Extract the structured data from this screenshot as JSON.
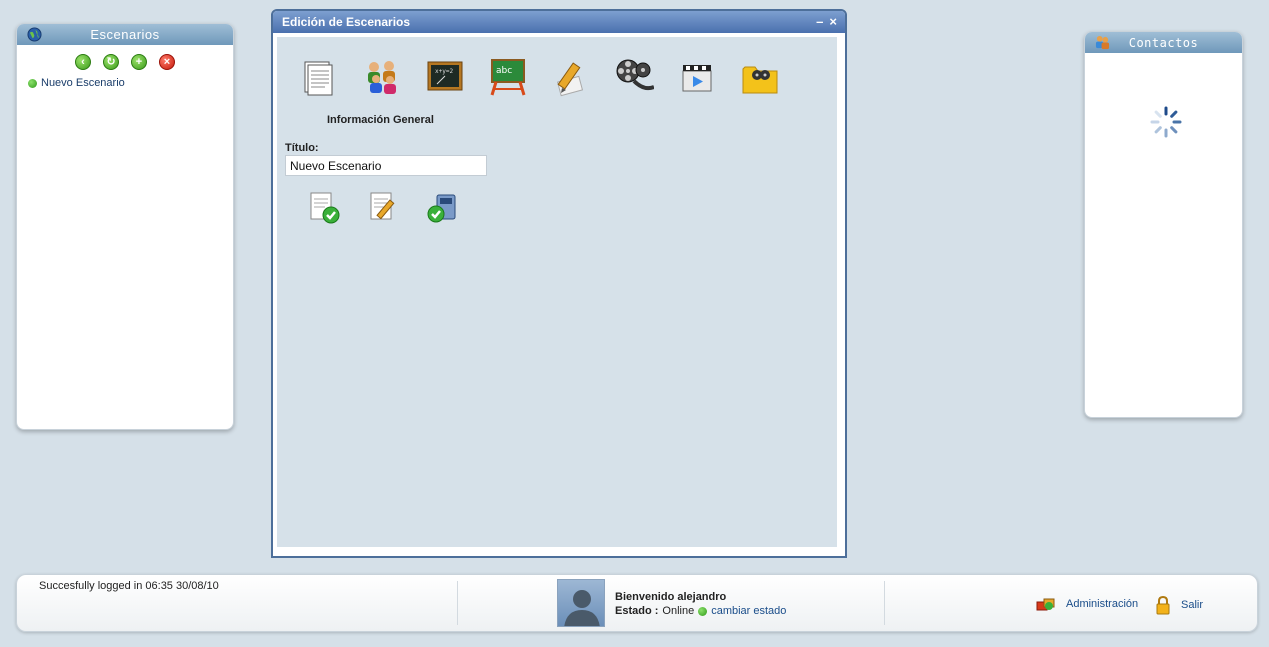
{
  "scenarios_panel": {
    "title": "Escenarios",
    "items": [
      {
        "label": "Nuevo Escenario"
      }
    ]
  },
  "contacts_panel": {
    "title": "Contactos"
  },
  "dialog": {
    "title": "Edición de Escenarios",
    "minimize": "–",
    "close": "×",
    "section_label": "Información General",
    "title_field_label": "Título:",
    "title_field_value": "Nuevo Escenario"
  },
  "footer": {
    "login_message": "Succesfully logged in 06:35 30/08/10",
    "welcome": "Bienvenido alejandro",
    "estado_label": "Estado :",
    "estado_value": "Online",
    "change_status": "cambiar estado",
    "admin_label": "Administración",
    "logout_label": "Salir"
  },
  "colors": {
    "header_blue": "#6f98ba",
    "dialog_title_blue": "#4a70ae",
    "status_green": "#2f9a1a",
    "link_blue": "#1a4d8a"
  }
}
